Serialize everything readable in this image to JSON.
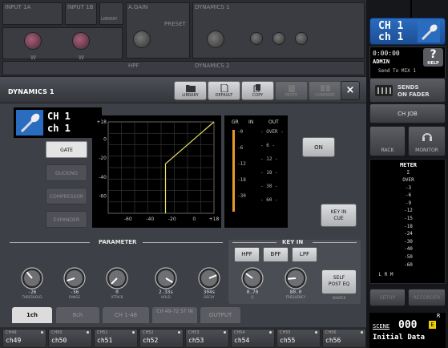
{
  "background": {
    "top_labels": [
      "INPUT 1A",
      "INPUT 1B",
      "LIBRARY",
      "A.GAIN",
      "PRESET",
      "DYNAMICS 1",
      "HPF",
      "EQ",
      "DYNAMICS 2"
    ],
    "w_labels": [
      "W",
      "W"
    ]
  },
  "side": {
    "ch_line1": "CH 1",
    "ch_line2": "ch 1",
    "time": "0:00:00",
    "user": "ADMIN",
    "send_to": "Send To MIX 1",
    "help_label": "HELP",
    "sends_line1": "SENDS",
    "sends_line2": "ON FADER",
    "ch_job": "CH JOB",
    "rack": "RACK",
    "monitor": "MONITOR",
    "meter_title": "METER",
    "meter_sigma": "Σ",
    "meter_scale": [
      "OVER",
      "-3",
      "-6",
      "-9",
      "-12",
      "-15",
      "-18",
      "-24",
      "-30",
      "-40",
      "-50",
      "-60"
    ],
    "meter_lrm": "L R M",
    "setup": "SETUP",
    "recorder": "RECORDER",
    "scene_label": "SCENE",
    "scene_num": "000",
    "scene_name": "Initial Data",
    "scene_r": "R",
    "help_q": "?"
  },
  "dialog": {
    "title": "DYNAMICS 1",
    "library": "LIBRARY",
    "default": "DEFAULT",
    "copy": "COPY",
    "paste": "PASTE",
    "compare": "COMPARE",
    "close": "×",
    "ch_line1": "CH 1",
    "ch_line2": "ch 1",
    "types": [
      {
        "label": "GATE",
        "active": true
      },
      {
        "label": "DUCKING",
        "active": false
      },
      {
        "label": "COMPRESSOR",
        "active": false
      },
      {
        "label": "EXPANDER",
        "active": false
      }
    ],
    "graph_y_labels": [
      "+18",
      "0",
      "-20",
      "-40",
      "-60"
    ],
    "graph_x_labels": [
      "-60",
      "-40",
      "-20",
      "0",
      "+18"
    ],
    "meter_head": [
      "GR",
      "IN",
      "OUT"
    ],
    "meter_gr_scale": [
      "-0",
      "-6",
      "-12",
      "-18",
      "-30"
    ],
    "meter_io_scale": [
      "OVER",
      "6",
      "12",
      "18",
      "30",
      "60"
    ],
    "on": "ON",
    "key_in_cue_1": "KEY IN",
    "key_in_cue_2": "CUE",
    "parameter_header": "PARAMETER",
    "key_in_header": "KEY IN",
    "params": [
      {
        "value": "-26",
        "label": "THRESHOLD",
        "level": 0.35
      },
      {
        "value": "-56",
        "label": "RANGE",
        "level": 0.1
      },
      {
        "value": "0",
        "label": "ATTACK",
        "level": 0.0
      },
      {
        "value": "2.33s",
        "label": "HOLD",
        "level": 0.95
      },
      {
        "value": "304s",
        "label": "DECAY",
        "level": 0.75
      }
    ],
    "filters": [
      "HPF",
      "BPF",
      "LPF"
    ],
    "key_params": [
      {
        "value": "0.70",
        "label": "Q",
        "level": 0.3
      },
      {
        "value": "80.0",
        "label": "FREQUENCY",
        "level": 0.15
      }
    ],
    "self_post_eq_1": "SELF",
    "self_post_eq_2": "POST EQ",
    "source_label": "SOURCE"
  },
  "tabs": [
    {
      "label": "1ch",
      "active": true
    },
    {
      "label": "8ch",
      "active": false
    },
    {
      "label": "CH 1-48",
      "active": false
    },
    {
      "label": "CH 49-72 ST IN",
      "active": false
    },
    {
      "label": "OUTPUT",
      "active": false
    }
  ],
  "strip": [
    {
      "top": "CH49",
      "name": "ch49"
    },
    {
      "top": "CH50",
      "name": "ch50"
    },
    {
      "top": "CH51",
      "name": "ch51"
    },
    {
      "top": "CH52",
      "name": "ch52"
    },
    {
      "top": "CH53",
      "name": "ch53"
    },
    {
      "top": "CH54",
      "name": "ch54"
    },
    {
      "top": "CH55",
      "name": "ch55"
    },
    {
      "top": "CH56",
      "name": "ch56"
    }
  ],
  "colors": {
    "accent_blue": "#2a6cc0",
    "meter_orange": "#e89a2c",
    "curve_yellow": "#e8e060",
    "scene_yellow": "#f0d000"
  }
}
